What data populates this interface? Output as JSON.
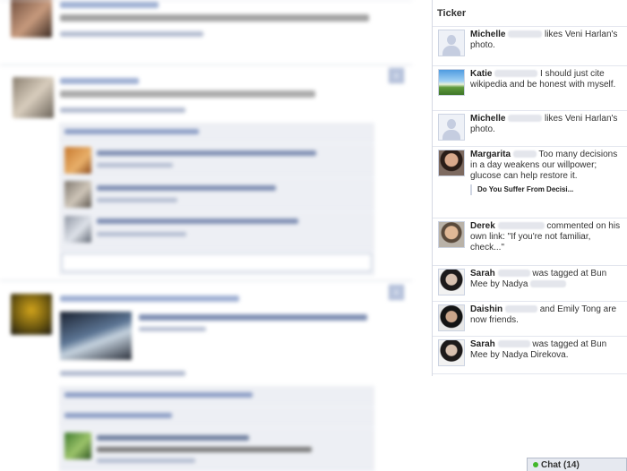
{
  "ticker": {
    "title": "Ticker",
    "items": [
      {
        "name": "Michelle",
        "text": "likes Veni Harlan's photo.",
        "pic": "default-avatar"
      },
      {
        "name": "Katie",
        "text": "I should just cite wikipedia and be honest with myself.",
        "pic": "landscape-photo"
      },
      {
        "name": "Michelle",
        "text": "likes Veni Harlan's photo.",
        "pic": "default-avatar"
      },
      {
        "name": "Margarita",
        "text": "Too many decisions in a day weakens our willpower; glucose can help restore it.",
        "link": "Do You Suffer From Decisi...",
        "pic": "woman-photo"
      },
      {
        "name": "Derek",
        "text": "commented on his own link: \"If you're not familiar, check...\"",
        "pic": "man-photo"
      },
      {
        "name": "Sarah",
        "text": "was tagged at Bun Mee by Nadya",
        "pic": "dark-portrait"
      },
      {
        "name": "Daishin",
        "text": "and Emily Tong are now friends.",
        "pic": "dark-portrait"
      },
      {
        "name": "Sarah",
        "text": "was tagged at Bun Mee by Nadya Direkova.",
        "pic": "dark-portrait"
      }
    ]
  },
  "chat": {
    "label": "Chat (14)"
  },
  "feed": {
    "blurred": true,
    "colors": {
      "link": "#3b5998",
      "comment_bg": "#edeff4"
    }
  }
}
